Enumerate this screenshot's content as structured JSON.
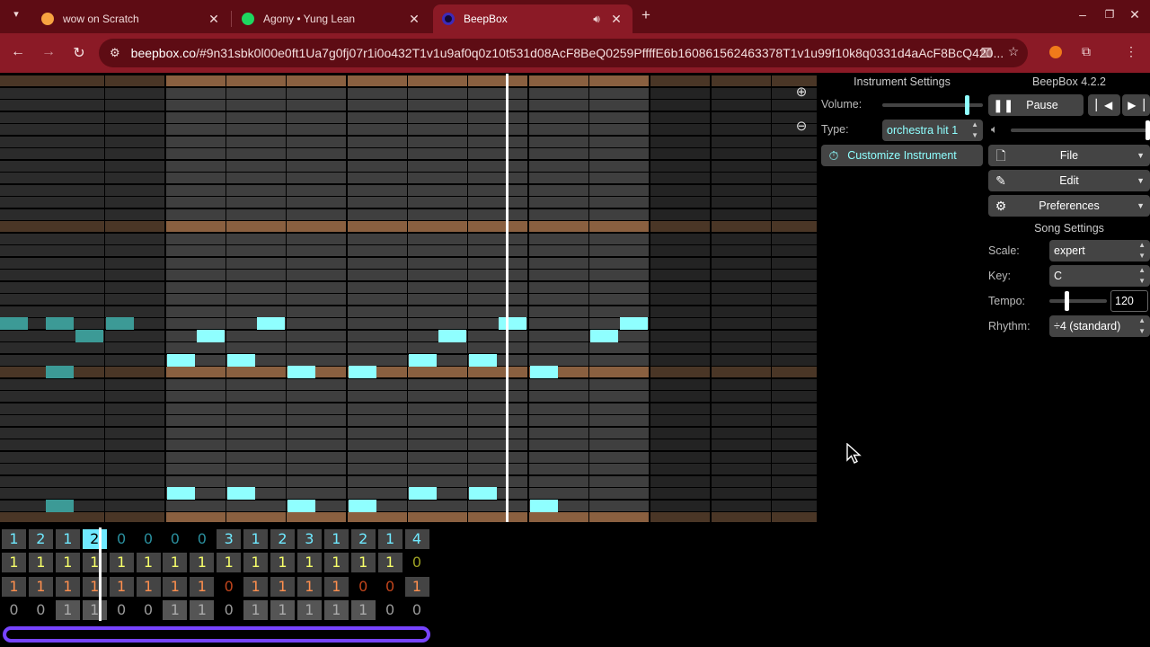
{
  "browser": {
    "tabs": [
      {
        "title": "wow on Scratch",
        "favicon_color": "#f7a441"
      },
      {
        "title": "Agony • Yung Lean",
        "favicon_color": "#1ed760"
      },
      {
        "title": "BeepBox",
        "favicon_color": "#3d2ab8"
      }
    ],
    "url_host": "beepbox.co",
    "url_rest": "/#9n31sbk0l00e0ft1Ua7g0fj07r1i0o432T1v1u9af0q0z10t531d08AcF8BeQ0259PffffE6b160861562463378T1v1u99f10k8q0331d4aAcF8BcQ420..."
  },
  "pattern_editor": {
    "note_color": "#8fffff",
    "dim_note_color": "#3c9a96",
    "octave_line_color": "#7a5532",
    "notes": [
      {
        "col": 0,
        "pitch": 15,
        "len": 0.5,
        "dim": true
      },
      {
        "col": 0,
        "pitch": 15,
        "len": 0.5,
        "dim": true,
        "start": 0.75
      },
      {
        "col": 1,
        "pitch": 14,
        "len": 0.5,
        "dim": true,
        "start": 0.5
      },
      {
        "col": 2,
        "pitch": 15,
        "len": 0.5,
        "dim": true
      },
      {
        "col": 1,
        "pitch": 11,
        "len": 0.5,
        "dim": true
      },
      {
        "col": 1,
        "pitch": 0,
        "len": 0.5,
        "dim": true
      },
      {
        "col": 3,
        "pitch": 12,
        "len": 0.5
      },
      {
        "col": 3,
        "pitch": 14,
        "len": 0.5,
        "start": 0.5
      },
      {
        "col": 4,
        "pitch": 12,
        "len": 0.5
      },
      {
        "col": 4,
        "pitch": 15,
        "len": 0.5,
        "start": 0.5
      },
      {
        "col": 5,
        "pitch": 11,
        "len": 0.5
      },
      {
        "col": 6,
        "pitch": 11,
        "len": 0.5
      },
      {
        "col": 7,
        "pitch": 12,
        "len": 0.5
      },
      {
        "col": 7,
        "pitch": 14,
        "len": 0.5,
        "start": 0.5
      },
      {
        "col": 8,
        "pitch": 12,
        "len": 0.5
      },
      {
        "col": 8,
        "pitch": 15,
        "len": 0.5,
        "start": 0.5
      },
      {
        "col": 9,
        "pitch": 11,
        "len": 0.5
      },
      {
        "col": 10,
        "pitch": 14,
        "len": 0.5
      },
      {
        "col": 10,
        "pitch": 15,
        "len": 0.5,
        "start": 0.5
      },
      {
        "col": 3,
        "pitch": 1,
        "len": 0.5
      },
      {
        "col": 4,
        "pitch": 1,
        "len": 0.5
      },
      {
        "col": 5,
        "pitch": 0,
        "len": 0.5
      },
      {
        "col": 6,
        "pitch": 0,
        "len": 0.5
      },
      {
        "col": 7,
        "pitch": 1,
        "len": 0.5
      },
      {
        "col": 8,
        "pitch": 1,
        "len": 0.5
      },
      {
        "col": 9,
        "pitch": 0,
        "len": 0.5
      }
    ]
  },
  "track_editor": {
    "rows": [
      {
        "color": "#6fe9ff",
        "values": [
          "1",
          "2",
          "1",
          "2",
          "0",
          "0",
          "0",
          "0",
          "3",
          "1",
          "2",
          "3",
          "1",
          "2",
          "1",
          "4"
        ]
      },
      {
        "color": "#f6ff6a",
        "values": [
          "1",
          "1",
          "1",
          "1",
          "1",
          "1",
          "1",
          "1",
          "1",
          "1",
          "1",
          "1",
          "1",
          "1",
          "1",
          "0"
        ]
      },
      {
        "color": "#ff8f4e",
        "values": [
          "1",
          "1",
          "1",
          "1",
          "1",
          "1",
          "1",
          "1",
          "0",
          "1",
          "1",
          "1",
          "1",
          "0",
          "0",
          "1"
        ]
      },
      {
        "color": "#aaaaaa",
        "values": [
          "0",
          "0",
          "1",
          "1",
          "0",
          "0",
          "1",
          "1",
          "0",
          "1",
          "1",
          "1",
          "1",
          "1",
          "0",
          "0"
        ]
      }
    ]
  },
  "instrument_settings": {
    "title": "Instrument Settings",
    "volume_label": "Volume:",
    "type_label": "Type:",
    "type_value": "orchestra hit 1",
    "customize_label": "Customize Instrument"
  },
  "song_panel": {
    "version": "BeepBox 4.2.2",
    "pause_label": "Pause",
    "file_label": "File",
    "edit_label": "Edit",
    "preferences_label": "Preferences",
    "song_settings_title": "Song Settings",
    "scale_label": "Scale:",
    "scale_value": "expert",
    "key_label": "Key:",
    "key_value": "C",
    "tempo_label": "Tempo:",
    "tempo_value": "120",
    "rhythm_label": "Rhythm:",
    "rhythm_value": "÷4 (standard)"
  },
  "colors": {
    "accent": "#8fffff",
    "loop_bar": "#7744ff",
    "chrome_dark": "#5e0c14",
    "chrome": "#8b1a26"
  }
}
